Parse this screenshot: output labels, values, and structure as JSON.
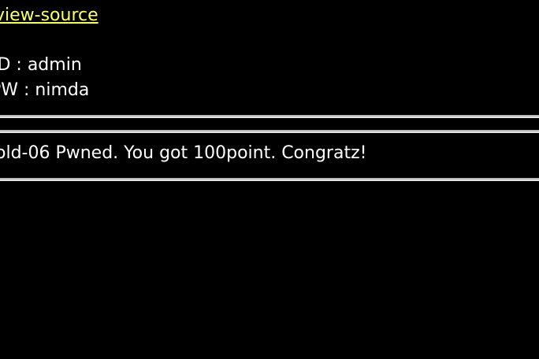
{
  "header": {
    "view_source_label": "view-source"
  },
  "credentials": {
    "id_text": "ID : admin",
    "pw_text": "PW : nimda"
  },
  "result": {
    "message": "old-06 Pwned. You got 100point. Congratz!"
  },
  "colors": {
    "background": "#000000",
    "text": "#ffffff",
    "link": "#ffff66"
  }
}
